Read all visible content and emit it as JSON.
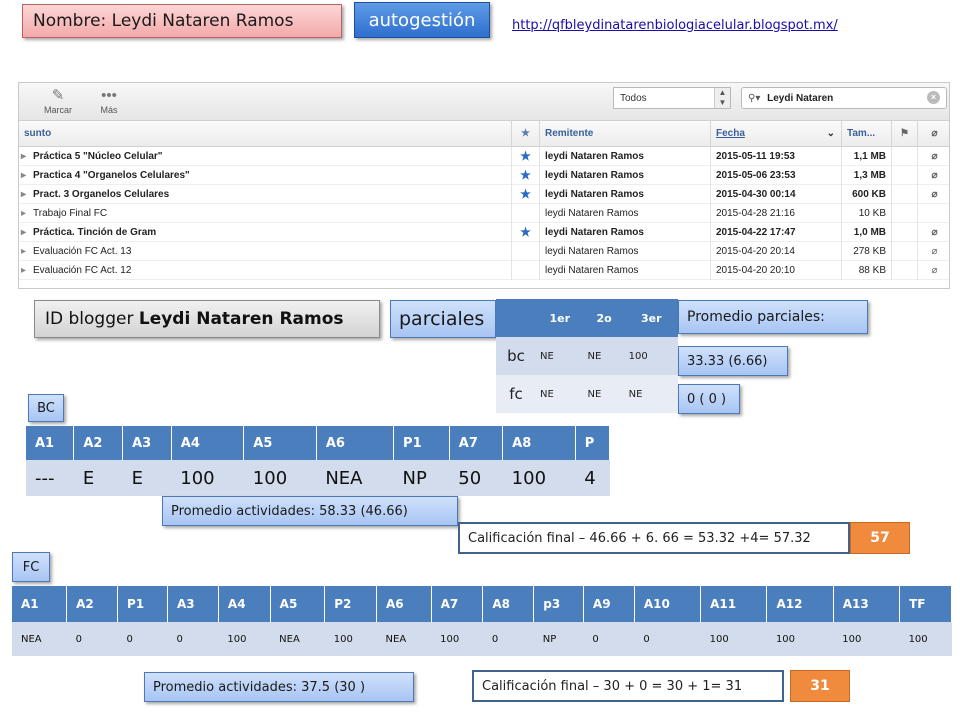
{
  "header": {
    "name_label": "Nombre: Leydi Nataren Ramos",
    "mode_label": "autogestión",
    "blog_url": "http://qfbleydinatarenbiologiacelular.blogspot.mx/"
  },
  "mail": {
    "toolbar": {
      "mark_label": "Marcar",
      "more_label": "Más"
    },
    "folder_select": "Todos",
    "search_value": "Leydi Nataren",
    "columns": {
      "subject": "sunto",
      "sender": "Remitente",
      "date": "Fecha",
      "size": "Tam..."
    },
    "rows": [
      {
        "subject": "Práctica 5 \"Núcleo Celular\"",
        "starred": true,
        "sender": "leydi Nataren Ramos",
        "date": "2015-05-11 19:53",
        "size": "1,1 MB",
        "attachment": true,
        "unread": true
      },
      {
        "subject": "Practica 4 \"Organelos Celulares\"",
        "starred": true,
        "sender": "leydi Nataren Ramos",
        "date": "2015-05-06 23:53",
        "size": "1,3 MB",
        "attachment": true,
        "unread": true
      },
      {
        "subject": "Pract. 3 Organelos Celulares",
        "starred": true,
        "sender": "leydi Nataren Ramos",
        "date": "2015-04-30 00:14",
        "size": "600 KB",
        "attachment": true,
        "unread": true
      },
      {
        "subject": "Trabajo Final FC",
        "starred": false,
        "sender": "leydi Nataren Ramos",
        "date": "2015-04-28 21:16",
        "size": "10 KB",
        "attachment": false,
        "unread": false
      },
      {
        "subject": "Práctica. Tinción de Gram",
        "starred": true,
        "sender": "leydi Nataren Ramos",
        "date": "2015-04-22 17:47",
        "size": "1,0 MB",
        "attachment": true,
        "unread": true
      },
      {
        "subject": "Evaluación FC Act. 13",
        "starred": false,
        "sender": "leydi Nataren Ramos",
        "date": "2015-04-20 20:14",
        "size": "278 KB",
        "attachment": true,
        "unread": false
      },
      {
        "subject": "Evaluación FC Act. 12",
        "starred": false,
        "sender": "leydi Nataren Ramos",
        "date": "2015-04-20 20:10",
        "size": "88 KB",
        "attachment": true,
        "unread": false
      }
    ]
  },
  "blogger": {
    "prefix": "ID blogger ",
    "name": "Leydi Nataren Ramos"
  },
  "parciales": {
    "label": "parciales",
    "headers": [
      "",
      "1er",
      "2o",
      "3er"
    ],
    "rows": [
      {
        "label": "bc",
        "values": [
          "NE",
          "NE",
          "100"
        ]
      },
      {
        "label": "fc",
        "values": [
          "NE",
          "NE",
          "NE"
        ]
      }
    ],
    "promedio_label": "Promedio parciales:",
    "promedio_bc": "33.33 (6.66)",
    "promedio_fc": "0 ( 0 )"
  },
  "bc": {
    "label": "BC",
    "headers": [
      "A1",
      "A2",
      "A3",
      "A4",
      "A5",
      "A6",
      "P1",
      "A7",
      "A8",
      "P"
    ],
    "values": [
      "---",
      "E",
      "E",
      "100",
      "100",
      "NEA",
      "NP",
      "50",
      "100",
      "4"
    ],
    "promedio": "Promedio actividades: 58.33 (46.66)",
    "calificacion": "Calificación final – 46.66 + 6. 66 = 53.32 +4= 57.32",
    "final_score": "57"
  },
  "fc": {
    "label": "FC",
    "headers": [
      "A1",
      "A2",
      "P1",
      "A3",
      "A4",
      "A5",
      "P2",
      "A6",
      "A7",
      "A8",
      "p3",
      "A9",
      "A10",
      "A11",
      "A12",
      "A13",
      "TF"
    ],
    "values": [
      "NEA",
      "0",
      "0",
      "0",
      "100",
      "NEA",
      "100",
      "NEA",
      "100",
      "0",
      "NP",
      "0",
      "0",
      "100",
      "100",
      "100",
      "100"
    ],
    "promedio": "Promedio actividades: 37.5 (30 )",
    "calificacion": "Calificación final – 30 + 0 = 30 + 1= 31",
    "final_score": "31"
  }
}
